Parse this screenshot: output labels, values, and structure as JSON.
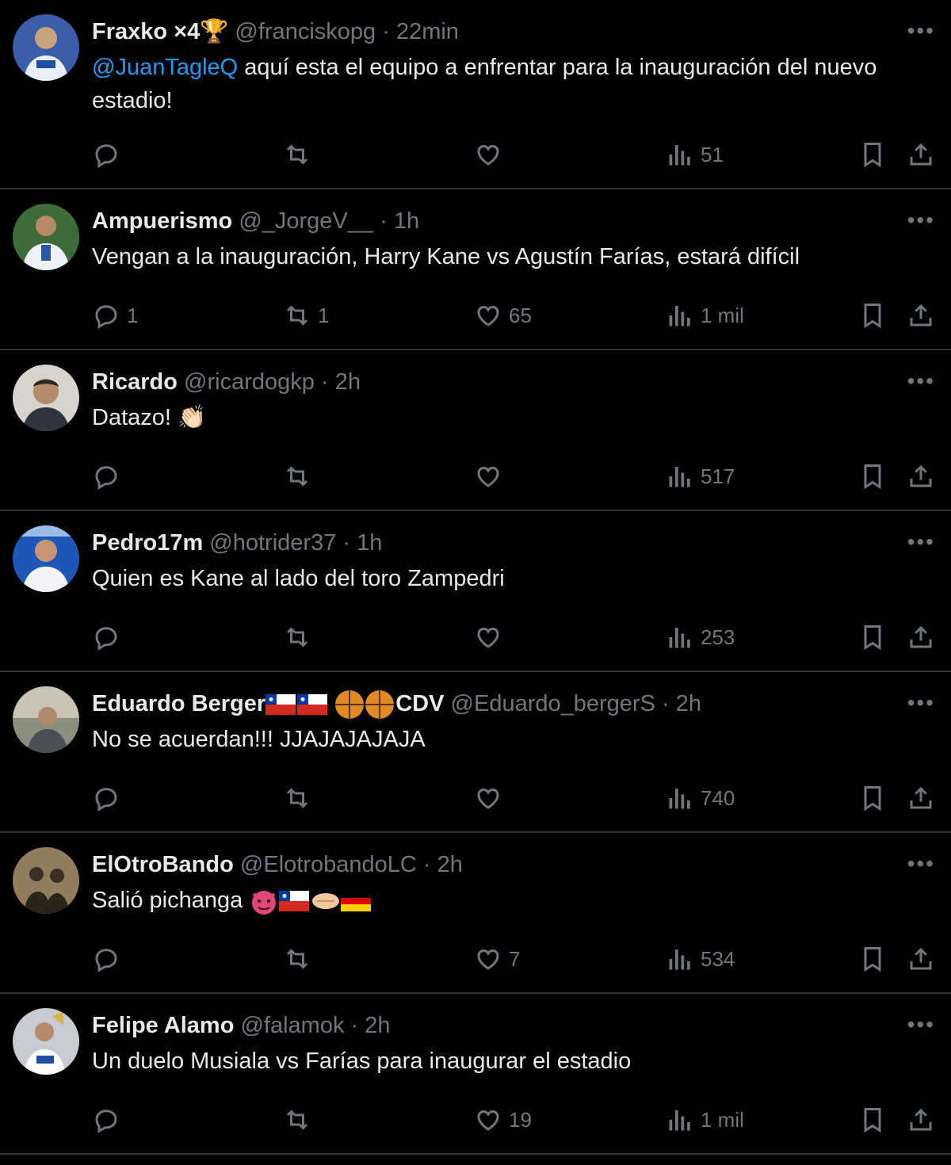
{
  "colors": {
    "background": "#000000",
    "text": "#e7e9ea",
    "muted": "#71767b",
    "link": "#1d9bf0",
    "divider": "#2f3336"
  },
  "icons": [
    "reply-icon",
    "retweet-icon",
    "like-icon",
    "views-icon",
    "bookmark-icon",
    "share-icon",
    "more-icon"
  ],
  "tweets": [
    {
      "name": "Fraxko ×4🏆",
      "handle": "@franciskopg",
      "dot": "·",
      "time": "22min",
      "mention": "@JuanTagleQ",
      "text": " aquí esta el equipo a enfrentar para la inauguración del nuevo estadio!",
      "replies": "",
      "retweets": "",
      "likes": "",
      "views": "51"
    },
    {
      "name": "Ampuerismo",
      "handle": "@_JorgeV__",
      "dot": "·",
      "time": "1h",
      "text": "Vengan a la inauguración, Harry Kane vs Agustín Farías, estará difícil",
      "replies": "1",
      "retweets": "1",
      "likes": "65",
      "views": "1 mil"
    },
    {
      "name": "Ricardo",
      "handle": "@ricardogkp",
      "dot": "·",
      "time": "2h",
      "text": "Datazo! 👏🏻",
      "replies": "",
      "retweets": "",
      "likes": "",
      "views": "517"
    },
    {
      "name": "Pedro17m",
      "handle": "@hotrider37",
      "dot": "·",
      "time": "1h",
      "text": "Quien es Kane al lado del toro Zampedri",
      "replies": "",
      "retweets": "",
      "likes": "",
      "views": "253"
    },
    {
      "name": "Eduardo Berger",
      "name_suffix": "CDV",
      "handle": "@Eduardo_bergerS",
      "dot": "·",
      "time": "2h",
      "text": "No se acuerdan!!! JJAJAJAJAJA",
      "replies": "",
      "retweets": "",
      "likes": "",
      "views": "740"
    },
    {
      "name": "ElOtroBando",
      "handle": "@ElotrobandoLC",
      "dot": "·",
      "time": "2h",
      "text": "Salió pichanga ",
      "replies": "",
      "retweets": "",
      "likes": "7",
      "views": "534"
    },
    {
      "name": "Felipe Alamo",
      "handle": "@falamok",
      "dot": "·",
      "time": "2h",
      "text": "Un duelo Musiala vs Farías para inaugurar el estadio",
      "replies": "",
      "retweets": "",
      "likes": "19",
      "views": "1 mil"
    }
  ]
}
